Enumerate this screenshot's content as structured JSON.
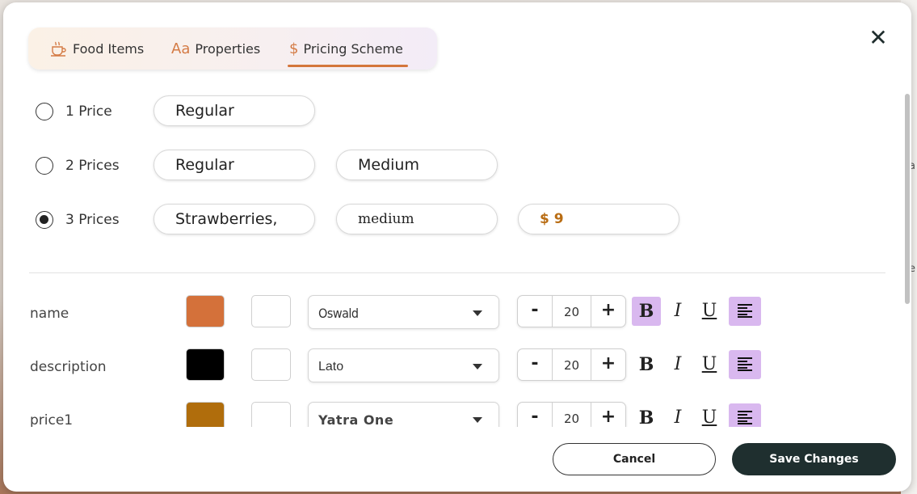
{
  "tabs": [
    {
      "label": "Food Items",
      "icon": "coffee-cup-icon",
      "active": false
    },
    {
      "label": "Properties",
      "icon": "font-aa-icon",
      "active": false
    },
    {
      "label": "Pricing Scheme",
      "icon": "dollar-icon",
      "active": true
    }
  ],
  "tab_icons": {
    "aa": "Aa",
    "dollar": "$"
  },
  "close_label": "✕",
  "pricing": [
    {
      "label": "1 Price",
      "selected": false,
      "fields": [
        "Regular"
      ]
    },
    {
      "label": "2 Prices",
      "selected": false,
      "fields": [
        "Regular",
        "Medium"
      ]
    },
    {
      "label": "3 Prices",
      "selected": true,
      "fields": [
        "Strawberries,",
        "medium",
        "$ 9"
      ]
    }
  ],
  "styles": [
    {
      "label": "name",
      "color": "#d4713a",
      "font": "Oswald",
      "size": "20",
      "bold": true,
      "italic": false,
      "underline": false
    },
    {
      "label": "description",
      "color": "#000000",
      "font": "Lato",
      "size": "20",
      "bold": false,
      "italic": false,
      "underline": false
    },
    {
      "label": "price1",
      "color": "#b06d0c",
      "font": "Yatra One",
      "size": "20",
      "bold": false,
      "italic": false,
      "underline": false
    }
  ],
  "format": {
    "bold": "B",
    "italic": "I",
    "underline": "U",
    "minus": "-",
    "plus": "+"
  },
  "backdrop_text": {
    "a": "a",
    "e": "e"
  },
  "buttons": {
    "cancel": "Cancel",
    "save": "Save Changes"
  },
  "colors": {
    "accent": "#d4763c",
    "dark": "#1f2f2f",
    "toggle_on": "#d9b8ef"
  }
}
